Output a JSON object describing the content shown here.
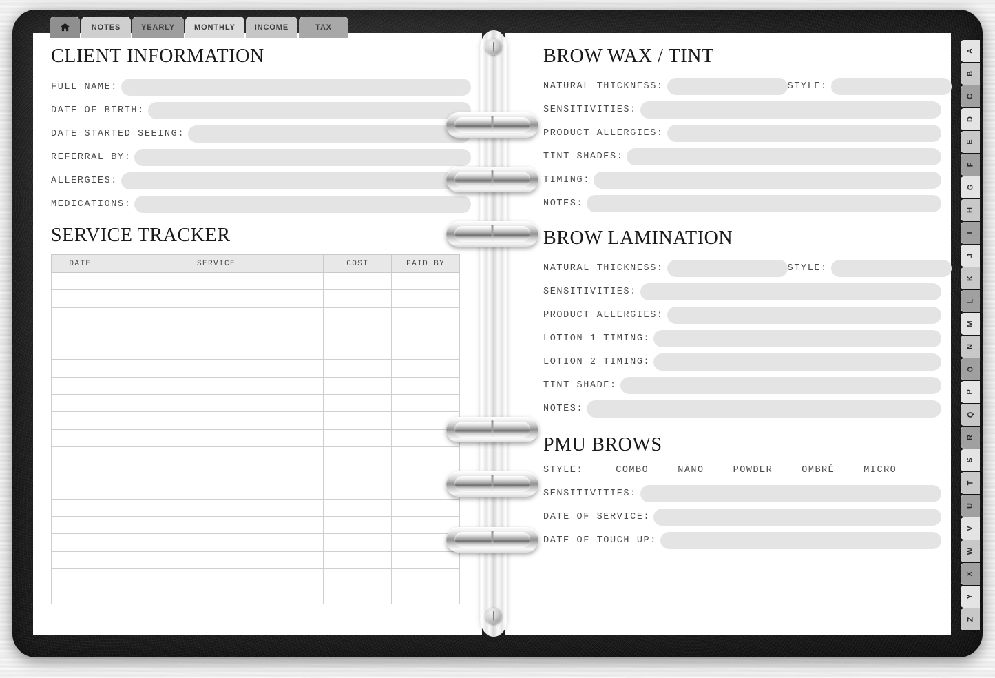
{
  "background": {
    "surface": "white-wood-texture",
    "binder_color": "#1b1b1b",
    "page_color": "#ffffff",
    "field_fill": "#e4e4e4"
  },
  "top_tabs": [
    {
      "label": "",
      "icon": "home-icon",
      "name": "home",
      "shade": "home"
    },
    {
      "label": "NOTES",
      "icon": null,
      "name": "notes",
      "shade": "shade-a"
    },
    {
      "label": "YEARLY",
      "icon": null,
      "name": "yearly",
      "shade": "shade-b"
    },
    {
      "label": "MONTHLY",
      "icon": null,
      "name": "monthly",
      "shade": "shade-c"
    },
    {
      "label": "INCOME",
      "icon": null,
      "name": "income",
      "shade": "shade-d"
    },
    {
      "label": "TAX",
      "icon": null,
      "name": "tax",
      "shade": "shade-e"
    }
  ],
  "alphabet_tabs": [
    "A",
    "B",
    "C",
    "D",
    "E",
    "F",
    "G",
    "H",
    "I",
    "J",
    "K",
    "L",
    "M",
    "N",
    "O",
    "P",
    "Q",
    "R",
    "S",
    "T",
    "U",
    "V",
    "W",
    "X",
    "Y",
    "Z"
  ],
  "left_page": {
    "client_information": {
      "title": "CLIENT INFORMATION",
      "fields": [
        {
          "label": "FULL NAME:",
          "value": ""
        },
        {
          "label": "DATE OF BIRTH:",
          "value": ""
        },
        {
          "label": "DATE STARTED SEEING:",
          "value": ""
        },
        {
          "label": "REFERRAL BY:",
          "value": ""
        },
        {
          "label": "ALLERGIES:",
          "value": ""
        },
        {
          "label": "MEDICATIONS:",
          "value": ""
        }
      ]
    },
    "service_tracker": {
      "title": "SERVICE TRACKER",
      "columns": [
        "DATE",
        "SERVICE",
        "COST",
        "PAID BY"
      ],
      "rows": [
        [
          "",
          "",
          "",
          ""
        ],
        [
          "",
          "",
          "",
          ""
        ],
        [
          "",
          "",
          "",
          ""
        ],
        [
          "",
          "",
          "",
          ""
        ],
        [
          "",
          "",
          "",
          ""
        ],
        [
          "",
          "",
          "",
          ""
        ],
        [
          "",
          "",
          "",
          ""
        ],
        [
          "",
          "",
          "",
          ""
        ],
        [
          "",
          "",
          "",
          ""
        ],
        [
          "",
          "",
          "",
          ""
        ],
        [
          "",
          "",
          "",
          ""
        ],
        [
          "",
          "",
          "",
          ""
        ],
        [
          "",
          "",
          "",
          ""
        ],
        [
          "",
          "",
          "",
          ""
        ],
        [
          "",
          "",
          "",
          ""
        ],
        [
          "",
          "",
          "",
          ""
        ],
        [
          "",
          "",
          "",
          ""
        ],
        [
          "",
          "",
          "",
          ""
        ],
        [
          "",
          "",
          "",
          ""
        ]
      ]
    }
  },
  "right_page": {
    "brow_wax_tint": {
      "title": "BROW WAX / TINT",
      "fields": [
        {
          "label": "NATURAL THICKNESS:",
          "value": "",
          "size": "short"
        },
        {
          "label": "STYLE:",
          "value": "",
          "size": "short",
          "inline": true
        },
        {
          "label": "SENSITIVITIES:",
          "value": ""
        },
        {
          "label": "PRODUCT ALLERGIES:",
          "value": ""
        },
        {
          "label": "TINT SHADES:",
          "value": ""
        },
        {
          "label": "TIMING:",
          "value": ""
        },
        {
          "label": "NOTES:",
          "value": ""
        }
      ]
    },
    "brow_lamination": {
      "title": "BROW LAMINATION",
      "fields": [
        {
          "label": "NATURAL THICKNESS:",
          "value": "",
          "size": "short"
        },
        {
          "label": "STYLE:",
          "value": "",
          "size": "short",
          "inline": true
        },
        {
          "label": "SENSITIVITIES:",
          "value": ""
        },
        {
          "label": "PRODUCT ALLERGIES:",
          "value": ""
        },
        {
          "label": "LOTION 1 TIMING:",
          "value": ""
        },
        {
          "label": "LOTION 2 TIMING:",
          "value": ""
        },
        {
          "label": "TINT SHADE:",
          "value": ""
        },
        {
          "label": "NOTES:",
          "value": ""
        }
      ]
    },
    "pmu_brows": {
      "title": "PMU BROWS",
      "style_label": "STYLE:",
      "style_options": [
        "COMBO",
        "NANO",
        "POWDER",
        "OMBRÉ",
        "MICRO"
      ],
      "fields": [
        {
          "label": "SENSITIVITIES:",
          "value": ""
        },
        {
          "label": "DATE OF SERVICE:",
          "value": ""
        },
        {
          "label": "DATE OF TOUCH UP:",
          "value": ""
        }
      ]
    }
  }
}
